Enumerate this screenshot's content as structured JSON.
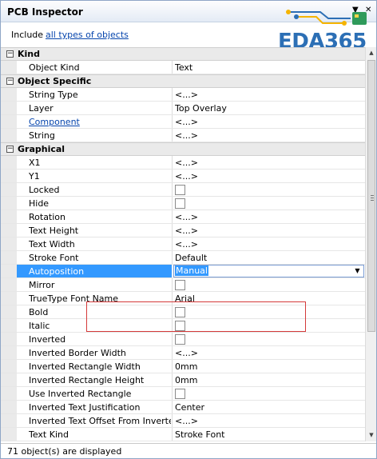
{
  "panel": {
    "title": "PCB Inspector",
    "buttons": {
      "menu": "▼",
      "close": "✕"
    }
  },
  "logo": {
    "text": "EDA365"
  },
  "include": {
    "label": "Include",
    "link_text": "all types of objects"
  },
  "categories": {
    "kind": {
      "toggle": "−",
      "label": "Kind"
    },
    "object_specific": {
      "toggle": "−",
      "label": "Object Specific"
    },
    "graphical": {
      "toggle": "−",
      "label": "Graphical"
    }
  },
  "kind": {
    "object_kind": {
      "name": "Object Kind",
      "value": "Text"
    }
  },
  "object_specific": {
    "string_type": {
      "name": "String Type",
      "value": "<...>"
    },
    "layer": {
      "name": "Layer",
      "value": "Top Overlay"
    },
    "component": {
      "name": "Component",
      "value": "<...>"
    },
    "string": {
      "name": "String",
      "value": "<...>"
    }
  },
  "graphical": {
    "x1": {
      "name": "X1",
      "value": "<...>"
    },
    "y1": {
      "name": "Y1",
      "value": "<...>"
    },
    "locked": {
      "name": "Locked",
      "checked": false
    },
    "hide": {
      "name": "Hide",
      "checked": false
    },
    "rotation": {
      "name": "Rotation",
      "value": "<...>"
    },
    "text_height": {
      "name": "Text Height",
      "value": "<...>"
    },
    "text_width": {
      "name": "Text Width",
      "value": "<...>"
    },
    "stroke_font": {
      "name": "Stroke Font",
      "value": "Default"
    },
    "autoposition": {
      "name": "Autoposition",
      "value": "Manual",
      "dropdown_arrow": "▼"
    },
    "mirror": {
      "name": "Mirror",
      "checked": false
    },
    "truetype_font_name": {
      "name": "TrueType Font Name",
      "value": "Arial"
    },
    "bold": {
      "name": "Bold",
      "checked": false
    },
    "italic": {
      "name": "Italic",
      "checked": false
    },
    "inverted": {
      "name": "Inverted",
      "checked": false
    },
    "inverted_border_width": {
      "name": "Inverted Border Width",
      "value": "<...>"
    },
    "inverted_rectangle_width": {
      "name": "Inverted Rectangle Width",
      "value": "0mm"
    },
    "inverted_rectangle_height": {
      "name": "Inverted Rectangle Height",
      "value": "0mm"
    },
    "use_inverted_rectangle": {
      "name": "Use Inverted Rectangle",
      "checked": false
    },
    "inverted_text_justification": {
      "name": "Inverted Text Justification",
      "value": "Center"
    },
    "inverted_text_offset": {
      "name": "Inverted Text Offset From Inverte...",
      "value": "<...>"
    },
    "text_kind": {
      "name": "Text Kind",
      "value": "Stroke Font"
    }
  },
  "scrollbar": {
    "up": "▲",
    "down": "▼"
  },
  "status": {
    "text": "71 object(s) are displayed"
  },
  "colors": {
    "selection": "#3399ff",
    "link": "#0645ad",
    "highlight_box": "#d43a3a",
    "logo": "#2c6fb5"
  }
}
